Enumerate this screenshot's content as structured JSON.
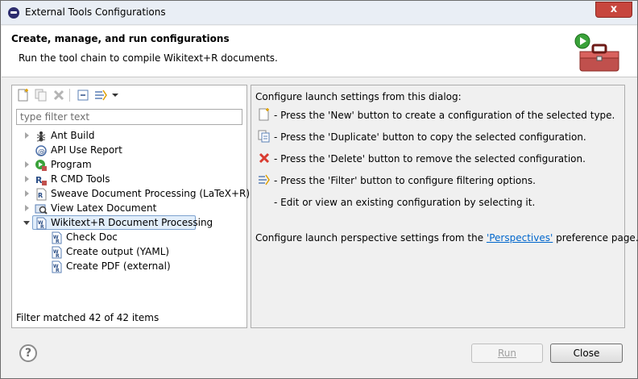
{
  "window": {
    "title": "External Tools Configurations",
    "close_glyph": "x"
  },
  "header": {
    "title": "Create, manage, and run configurations",
    "subtitle": "Run the tool chain to compile Wikitext+R documents."
  },
  "left_panel": {
    "toolbar_icons": [
      "new-config-icon",
      "duplicate-icon",
      "delete-icon",
      "collapse-all-icon",
      "filter-icon",
      "dropdown-arrow-icon"
    ],
    "filter_placeholder": "type filter text",
    "tree": [
      {
        "label": "Ant Build",
        "icon": "ant-icon",
        "expanded": false,
        "level": 0
      },
      {
        "label": "API Use Report",
        "icon": "api-report-icon",
        "expanded": null,
        "level": 0
      },
      {
        "label": "Program",
        "icon": "program-icon",
        "expanded": false,
        "level": 0
      },
      {
        "label": "R CMD Tools",
        "icon": "r-cmd-icon",
        "expanded": false,
        "level": 0
      },
      {
        "label": "Sweave Document Processing (LaTeX+R)",
        "icon": "sweave-icon",
        "expanded": false,
        "level": 0
      },
      {
        "label": "View Latex Document",
        "icon": "view-latex-icon",
        "expanded": false,
        "level": 0
      },
      {
        "label": "Wikitext+R Document Processing",
        "icon": "wikitext-icon",
        "expanded": true,
        "level": 0,
        "selected": true
      },
      {
        "label": "Check Doc",
        "icon": "wikitext-doc-icon",
        "level": 1
      },
      {
        "label": "Create output (YAML)",
        "icon": "wikitext-doc-icon",
        "level": 1
      },
      {
        "label": "Create PDF (external)",
        "icon": "wikitext-doc-icon",
        "level": 1
      }
    ],
    "footer": "Filter matched 42 of 42 items"
  },
  "right_panel": {
    "intro": "Configure launch settings from this dialog:",
    "items": [
      {
        "icon": "new-config-icon",
        "text": "- Press the 'New' button to create a configuration of the selected type."
      },
      {
        "icon": "duplicate-icon",
        "text": "- Press the 'Duplicate' button to copy the selected configuration."
      },
      {
        "icon": "delete-icon",
        "text": "- Press the 'Delete' button to remove the selected configuration."
      },
      {
        "icon": "filter-icon",
        "text": "- Press the 'Filter' button to configure filtering options."
      },
      {
        "icon": "",
        "text": "- Edit or view an existing configuration by selecting it."
      }
    ],
    "perspective_prefix": "Configure launch perspective settings from the ",
    "perspective_link": "'Perspectives'",
    "perspective_suffix": " preference page."
  },
  "footer": {
    "help_glyph": "?",
    "run_label": "Run",
    "close_label": "Close"
  }
}
